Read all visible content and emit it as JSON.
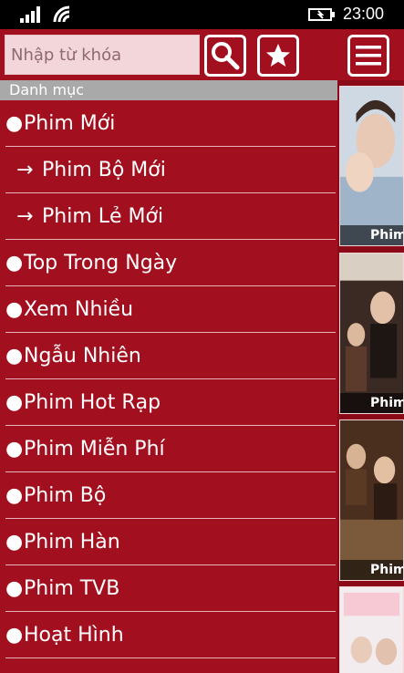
{
  "status": {
    "time": "23:00",
    "icons": [
      "signal-icon",
      "wifi-icon",
      "battery-charging-icon"
    ]
  },
  "toolbar": {
    "search_placeholder": "Nhập từ khóa",
    "icons": [
      "search-icon",
      "star-icon",
      "hamburger-menu-icon"
    ]
  },
  "category": {
    "header": "Danh mục",
    "items": [
      {
        "label": "Phim Mới",
        "marker": "●"
      },
      {
        "label": "Phim Bộ Mới",
        "marker": "→"
      },
      {
        "label": "Phim Lẻ Mới",
        "marker": "→"
      },
      {
        "label": "Top Trong Ngày",
        "marker": "●"
      },
      {
        "label": "Xem Nhiều",
        "marker": "●"
      },
      {
        "label": "Ngẫu Nhiên",
        "marker": "●"
      },
      {
        "label": "Phim Hot Rạp",
        "marker": "●"
      },
      {
        "label": "Phim Miễn Phí",
        "marker": "●"
      },
      {
        "label": "Phim Bộ",
        "marker": "●"
      },
      {
        "label": "Phim Hàn",
        "marker": "●"
      },
      {
        "label": "Phim TVB",
        "marker": "●"
      },
      {
        "label": "Hoạt Hình",
        "marker": "●"
      }
    ]
  },
  "posters": [
    {
      "caption": "Phim"
    },
    {
      "caption": "Phim"
    },
    {
      "caption": "Phim"
    },
    {
      "caption": ""
    }
  ],
  "colors": {
    "brand_red": "#a20f1f",
    "header_gray": "#a9a9a9",
    "search_bg": "#f2d6d9"
  }
}
